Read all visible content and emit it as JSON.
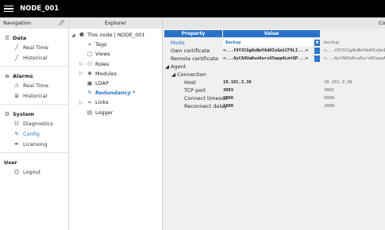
{
  "app": {
    "title": "NODE_001"
  },
  "navigation": {
    "header": "Navigation",
    "groups": [
      {
        "label": "Data",
        "items": [
          "Real Time",
          "Historical"
        ]
      },
      {
        "label": "Alarms",
        "items": [
          "Real Time",
          "Historical"
        ]
      },
      {
        "label": "System",
        "items": [
          "Diagnostics",
          "Config",
          "Licensing"
        ]
      },
      {
        "label": "User",
        "items": [
          "Logout"
        ]
      }
    ]
  },
  "explorer": {
    "header": "Explorer",
    "root": "This node | NODE_001",
    "items": [
      "Tags",
      "Views",
      "Roles",
      "Modules",
      "LDAP",
      "Redundancy *",
      "Links",
      "Logger"
    ]
  },
  "properties": {
    "headers": {
      "property": "Property",
      "value": "Value",
      "third": "Co"
    },
    "rows": {
      "mode": {
        "label": "Mode",
        "value": "Backup",
        "value2": "backup"
      },
      "own_cert": {
        "label": "Own certificate",
        "value": "<...fXY3CGg0uBmYAdHIzGm1CF9LI...>",
        "value2": "<...fXY3CGg0uBmYAdHIzGm1CF9..."
      },
      "remote_cert": {
        "label": "Remote certificate",
        "value": "<...AyCA8UaKuxKurs65eppALmtQP...>",
        "value2": "<...AyCA8UaKuxKurs65eppAL..."
      },
      "agent": {
        "label": "Agent"
      },
      "connection": {
        "label": "Connection"
      },
      "host": {
        "label": "Host",
        "value": "10.101.3.36",
        "value2": "10.101.3.36"
      },
      "tcp_port": {
        "label": "TCP port",
        "value": "3003",
        "value2": "3003"
      },
      "connect_timeout": {
        "label": "Connect timeout",
        "value": "5000",
        "value2": "5000"
      },
      "reconnect_delay": {
        "label": "Reconnect delay",
        "value": "1000",
        "value2": "1000"
      }
    }
  }
}
